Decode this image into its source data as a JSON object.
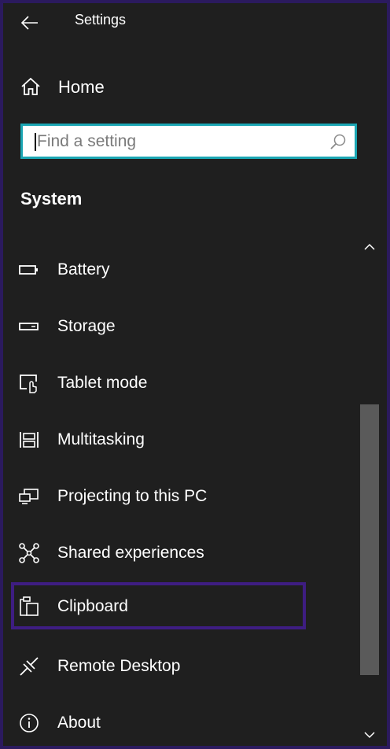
{
  "window": {
    "title": "Settings"
  },
  "home": {
    "label": "Home",
    "icon": "home-icon"
  },
  "search": {
    "placeholder": "Find a setting",
    "value": "",
    "icon": "search-icon"
  },
  "section": {
    "title": "System"
  },
  "nav": {
    "items": [
      {
        "label": "Battery",
        "icon": "battery-icon"
      },
      {
        "label": "Storage",
        "icon": "storage-icon"
      },
      {
        "label": "Tablet mode",
        "icon": "tablet-mode-icon"
      },
      {
        "label": "Multitasking",
        "icon": "multitasking-icon"
      },
      {
        "label": "Projecting to this PC",
        "icon": "projecting-icon"
      },
      {
        "label": "Shared experiences",
        "icon": "shared-experiences-icon"
      },
      {
        "label": "Clipboard",
        "icon": "clipboard-icon",
        "selected": true
      },
      {
        "label": "Remote Desktop",
        "icon": "remote-desktop-icon"
      },
      {
        "label": "About",
        "icon": "info-icon"
      }
    ]
  },
  "colors": {
    "background": "#1f1f1f",
    "frame": "#2b1a5e",
    "search_border": "#1ba6b3",
    "selection_border": "#3e1d82",
    "scrollbar_thumb": "#5a5a5a"
  }
}
